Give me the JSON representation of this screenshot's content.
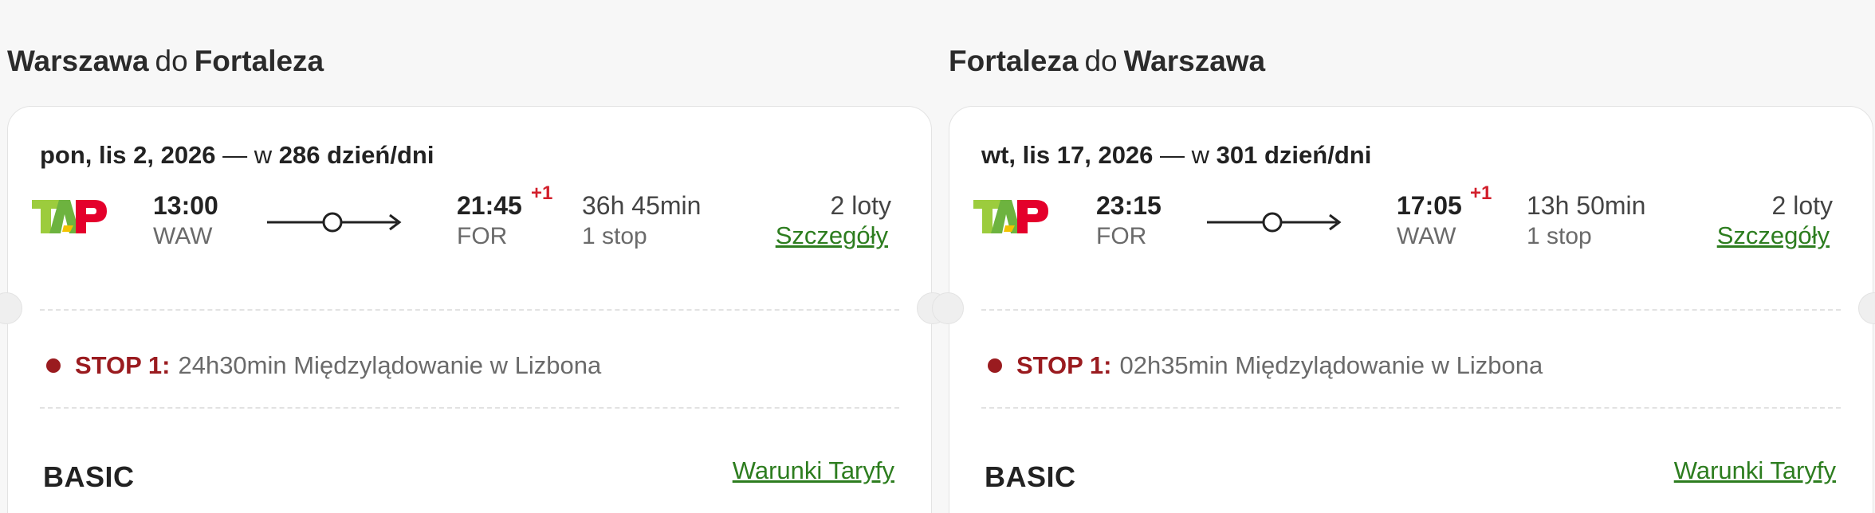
{
  "legs": [
    {
      "heading": {
        "from": "Warszawa",
        "sep": "do",
        "to": "Fortaleza"
      },
      "date": {
        "day": "pon, lis 2, 2026",
        "sep": " — w ",
        "days": "286 dzień/dni"
      },
      "departure": {
        "time": "13:00",
        "code": "WAW"
      },
      "arrival": {
        "time": "21:45",
        "plus": "+1",
        "code": "FOR"
      },
      "duration": "36h 45min",
      "stops": "1 stop",
      "flights": "2 loty",
      "details_link": "Szczegóły",
      "stop": {
        "label": "STOP 1:",
        "text": "24h30min Międzylądowanie w Lizbona"
      },
      "fare": {
        "name": "BASIC",
        "terms_link": "Warunki Taryfy"
      }
    },
    {
      "heading": {
        "from": "Fortaleza",
        "sep": "do",
        "to": "Warszawa"
      },
      "date": {
        "day": "wt, lis 17, 2026",
        "sep": " — w ",
        "days": "301 dzień/dni"
      },
      "departure": {
        "time": "23:15",
        "code": "FOR"
      },
      "arrival": {
        "time": "17:05",
        "plus": "+1",
        "code": "WAW"
      },
      "duration": "13h 50min",
      "stops": "1 stop",
      "flights": "2 loty",
      "details_link": "Szczegóły",
      "stop": {
        "label": "STOP 1:",
        "text": "02h35min Międzylądowanie w Lizbona"
      },
      "fare": {
        "name": "BASIC",
        "terms_link": "Warunki Taryfy"
      }
    }
  ],
  "airline_logo": {
    "icon": "tap-airline-logo",
    "colors": {
      "green": "#8cc63f",
      "red": "#e4002b",
      "yellow": "#f2c300"
    }
  },
  "colors": {
    "accent_link": "#2d7d1f",
    "stop_red": "#9a1b1f",
    "plus_red": "#d21f2b"
  }
}
